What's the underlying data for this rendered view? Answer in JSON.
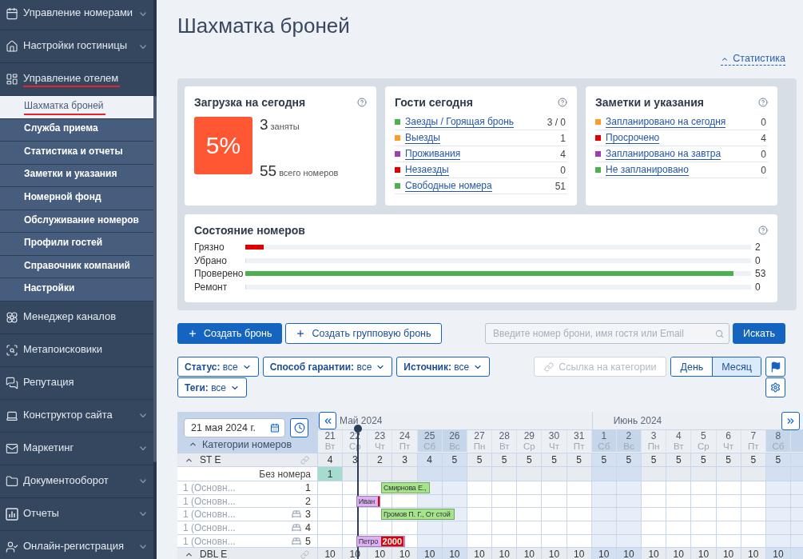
{
  "sidebar": {
    "items": [
      {
        "label": "Управление номерами",
        "caret": true,
        "annotated": false
      },
      {
        "label": "Настройки гостиницы",
        "caret": true,
        "annotated": false
      },
      {
        "label": "Управление отелем",
        "caret": false,
        "annotated": true,
        "children": [
          {
            "label": "Шахматка броней",
            "selected": true,
            "annotated": true
          },
          {
            "label": "Служба приема",
            "selected": false,
            "annotated": false
          },
          {
            "label": "Статистика и отчеты",
            "selected": false,
            "annotated": false
          },
          {
            "label": "Заметки и указания",
            "selected": false,
            "annotated": false
          },
          {
            "label": "Номерной фонд",
            "selected": false,
            "annotated": false
          },
          {
            "label": "Обслуживание номеров",
            "selected": false,
            "annotated": false
          },
          {
            "label": "Профили гостей",
            "selected": false,
            "annotated": false
          },
          {
            "label": "Справочник компаний",
            "selected": false,
            "annotated": false
          },
          {
            "label": "Настройки",
            "selected": false,
            "annotated": false
          }
        ]
      },
      {
        "label": "Менеджер каналов",
        "caret": false,
        "annotated": false
      },
      {
        "label": "Метапоисковики",
        "caret": false,
        "annotated": false
      },
      {
        "label": "Репутация",
        "caret": false,
        "annotated": false
      },
      {
        "label": "Конструктор сайта",
        "caret": true,
        "annotated": false
      },
      {
        "label": "Маркетинг",
        "caret": true,
        "annotated": false
      },
      {
        "label": "Документооборот",
        "caret": true,
        "annotated": false
      },
      {
        "label": "Отчеты",
        "caret": true,
        "annotated": false
      },
      {
        "label": "Онлайн-регистрация",
        "caret": true,
        "annotated": false
      }
    ]
  },
  "title": "Шахматка броней",
  "statistics_toggle": {
    "label": "Статистика",
    "expanded": true
  },
  "load_card": {
    "title": "Загрузка на сегодня",
    "percent": "5%",
    "occupied": "3",
    "occupied_label": "заняты",
    "total": "55",
    "total_label": "всего номеров"
  },
  "guests_card": {
    "title": "Гости сегодня",
    "rows": [
      {
        "label": "Заезды / Горящая бронь",
        "value": "3 / 0",
        "color": "#4caf50"
      },
      {
        "label": "Выезды",
        "value": "1",
        "color": "#ff9a2e"
      },
      {
        "label": "Проживания",
        "value": "4",
        "color": "#9c3fb5"
      },
      {
        "label": "Незаезды",
        "value": "0",
        "color": "#e00000"
      },
      {
        "label": "Свободные номера",
        "value": "51",
        "color": "#4caf50"
      }
    ]
  },
  "notes_card": {
    "title": "Заметки и указания",
    "rows": [
      {
        "label": "Запланировано на сегодня",
        "value": "0",
        "color": "#ff9a2e"
      },
      {
        "label": "Просрочено",
        "value": "4",
        "color": "#e00000"
      },
      {
        "label": "Запланировано на завтра",
        "value": "0",
        "color": "#9c3fb5"
      },
      {
        "label": "Не запланировано",
        "value": "0",
        "color": "#4caf50"
      }
    ]
  },
  "rooms_card": {
    "title": "Состояние номеров",
    "rows": [
      {
        "label": "Грязно",
        "value": "2",
        "level": 0.036,
        "color": "#e00000"
      },
      {
        "label": "Убрано",
        "value": "0",
        "level": 0
      },
      {
        "label": "Проверено",
        "value": "53",
        "level": 0.965,
        "color": "#4caf50"
      },
      {
        "label": "Ремонт",
        "value": "0",
        "level": 0
      }
    ]
  },
  "actions": {
    "create": "Создать бронь",
    "create_group": "Создать групповую бронь",
    "search": {
      "placeholder": "Введите номер брони, имя гостя или Email"
    },
    "search_button": "Искать"
  },
  "filters": [
    {
      "label": "Статус:",
      "value": "все"
    },
    {
      "label": "Способ гарантии:",
      "value": "все"
    },
    {
      "label": "Источник:",
      "value": "все"
    },
    {
      "label": "Теги:",
      "value": "все"
    }
  ],
  "category_link": {
    "label": "Ссылка на категории",
    "disabled": true
  },
  "view_tabs": [
    {
      "label": "День",
      "selected": false
    },
    {
      "label": "Месяц",
      "selected": true
    }
  ],
  "calendar": {
    "date": "21 мая 2024 г.",
    "categories_header": "Категории номеров",
    "categories_expanded": true,
    "months": [
      {
        "label": "Май 2024",
        "days": [
          {
            "day": "21",
            "weekday": "Вт",
            "weekend": false
          },
          {
            "day": "22",
            "weekday": "Ср",
            "weekend": false
          },
          {
            "day": "23",
            "weekday": "Чт",
            "weekend": false
          },
          {
            "day": "24",
            "weekday": "Пт",
            "weekend": false
          },
          {
            "day": "25",
            "weekday": "Сб",
            "weekend": true
          },
          {
            "day": "26",
            "weekday": "Вс",
            "weekend": true
          },
          {
            "day": "27",
            "weekday": "Пн",
            "weekend": false
          },
          {
            "day": "28",
            "weekday": "Вт",
            "weekend": false
          },
          {
            "day": "29",
            "weekday": "Ср",
            "weekend": false
          },
          {
            "day": "30",
            "weekday": "Чт",
            "weekend": false
          },
          {
            "day": "31",
            "weekday": "Пт",
            "weekend": false
          }
        ]
      },
      {
        "label": "Июнь 2024",
        "days": [
          {
            "day": "1",
            "weekday": "Сб",
            "weekend": true
          },
          {
            "day": "2",
            "weekday": "Вс",
            "weekend": true
          },
          {
            "day": "3",
            "weekday": "Пн",
            "weekend": false
          },
          {
            "day": "4",
            "weekday": "Вт",
            "weekend": false
          },
          {
            "day": "5",
            "weekday": "Ср",
            "weekend": false
          },
          {
            "day": "6",
            "weekday": "Чт",
            "weekend": false
          },
          {
            "day": "7",
            "weekday": "Пт",
            "weekend": false
          },
          {
            "day": "8",
            "weekday": "Сб",
            "weekend": true
          }
        ]
      }
    ],
    "categories": [
      {
        "name": "ST E",
        "expanded": true,
        "counts": [
          "4",
          "3",
          "2",
          "3",
          "4",
          "5",
          "5",
          "5",
          "5",
          "5",
          "5",
          "5",
          "5",
          "5",
          "5",
          "5",
          "5",
          "5",
          "5"
        ],
        "unassigned": {
          "label": "Без номера",
          "counts": [
            "1"
          ]
        },
        "rooms": [
          {
            "type": "1 (Основн...",
            "number": "1",
            "kind": "plain",
            "cells": [
              {
                "kind": "free"
              },
              {
                "kind": "free"
              },
              {
                "kind": "start",
                "guest": "Смирнова Е.,",
                "color": "#a6e48c",
                "end_mark": false
              },
              {
                "kind": "stay"
              },
              {
                "kind": "free"
              },
              {
                "kind": "free"
              },
              {
                "kind": "free"
              },
              {
                "kind": "free"
              },
              {
                "kind": "free"
              },
              {
                "kind": "free"
              },
              {
                "kind": "free"
              },
              {
                "kind": "free"
              },
              {
                "kind": "free"
              },
              {
                "kind": "free"
              },
              {
                "kind": "free"
              },
              {
                "kind": "free"
              },
              {
                "kind": "free"
              },
              {
                "kind": "free"
              },
              {
                "kind": "free"
              }
            ]
          },
          {
            "type": "1 (Основн...",
            "number": "2",
            "kind": "plain",
            "cells": [
              {
                "kind": "free"
              },
              {
                "kind": "start",
                "guest": "Иван",
                "color": "#dcb0f3",
                "end_mark": true
              },
              {
                "kind": "free"
              },
              {
                "kind": "free"
              },
              {
                "kind": "free"
              },
              {
                "kind": "free"
              },
              {
                "kind": "free"
              },
              {
                "kind": "free"
              },
              {
                "kind": "free"
              },
              {
                "kind": "free"
              },
              {
                "kind": "free"
              },
              {
                "kind": "free"
              },
              {
                "kind": "free"
              },
              {
                "kind": "free"
              },
              {
                "kind": "free"
              },
              {
                "kind": "free"
              },
              {
                "kind": "free"
              },
              {
                "kind": "free"
              },
              {
                "kind": "free"
              }
            ]
          },
          {
            "type": "1 (Основн...",
            "number": "3",
            "kind": "icon",
            "cells": [
              {
                "kind": "free"
              },
              {
                "kind": "free"
              },
              {
                "kind": "start",
                "guest": "Громов П. Г., От стой",
                "color": "#a6e48c",
                "end_mark": false
              },
              {
                "kind": "stay"
              },
              {
                "kind": "stay"
              },
              {
                "kind": "free"
              },
              {
                "kind": "free"
              },
              {
                "kind": "free"
              },
              {
                "kind": "free"
              },
              {
                "kind": "free"
              },
              {
                "kind": "free"
              },
              {
                "kind": "free"
              },
              {
                "kind": "free"
              },
              {
                "kind": "free"
              },
              {
                "kind": "free"
              },
              {
                "kind": "free"
              },
              {
                "kind": "free"
              },
              {
                "kind": "free"
              },
              {
                "kind": "free"
              }
            ]
          },
          {
            "type": "1 (Основн...",
            "number": "4",
            "kind": "icon",
            "cells": [
              {
                "kind": "free"
              },
              {
                "kind": "free"
              },
              {
                "kind": "free"
              },
              {
                "kind": "free"
              },
              {
                "kind": "free"
              },
              {
                "kind": "free"
              },
              {
                "kind": "free"
              },
              {
                "kind": "free"
              },
              {
                "kind": "free"
              },
              {
                "kind": "free"
              },
              {
                "kind": "free"
              },
              {
                "kind": "free"
              },
              {
                "kind": "free"
              },
              {
                "kind": "free"
              },
              {
                "kind": "free"
              },
              {
                "kind": "free"
              },
              {
                "kind": "free"
              },
              {
                "kind": "free"
              },
              {
                "kind": "free"
              }
            ]
          },
          {
            "type": "1 (Основн...",
            "number": "5",
            "kind": "icon",
            "cells": [
              {
                "kind": "free"
              },
              {
                "kind": "start",
                "guest": "Петро",
                "color": "#dcb0f3",
                "end_mark": false,
                "badge": "2000"
              },
              {
                "kind": "stay"
              },
              {
                "kind": "free"
              },
              {
                "kind": "free"
              },
              {
                "kind": "free"
              },
              {
                "kind": "free"
              },
              {
                "kind": "free"
              },
              {
                "kind": "free"
              },
              {
                "kind": "free"
              },
              {
                "kind": "free"
              },
              {
                "kind": "free"
              },
              {
                "kind": "free"
              },
              {
                "kind": "free"
              },
              {
                "kind": "free"
              },
              {
                "kind": "free"
              },
              {
                "kind": "free"
              },
              {
                "kind": "free"
              },
              {
                "kind": "free"
              }
            ]
          }
        ]
      },
      {
        "name": "DBL E",
        "expanded": true,
        "counts": [
          "10",
          "10",
          "10",
          "10",
          "10",
          "10",
          "10",
          "10",
          "10",
          "10",
          "10",
          "10",
          "10",
          "10",
          "10",
          "10",
          "10",
          "10",
          "10"
        ]
      }
    ]
  }
}
